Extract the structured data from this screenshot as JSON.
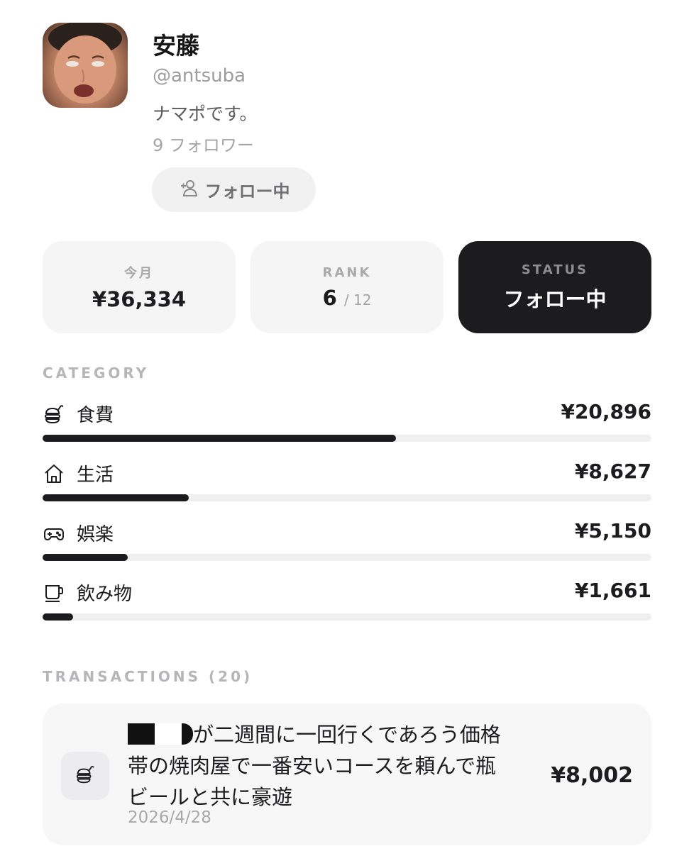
{
  "profile": {
    "name": "安藤",
    "handle": "@antsuba",
    "bio": "ナマポです。",
    "followers": "9 フォロワー",
    "follow_button": "フォロー中"
  },
  "stats": {
    "month": {
      "label": "今月",
      "value": "¥36,334"
    },
    "rank": {
      "label": "RANK",
      "value": "6",
      "total": "/ 12"
    },
    "status": {
      "label": "STATUS",
      "value": "フォロー中"
    }
  },
  "category_label": "CATEGORY",
  "categories": [
    {
      "name": "食費",
      "amount": "¥20,896",
      "icon": "food-icon",
      "share": 0.58
    },
    {
      "name": "生活",
      "amount": "¥8,627",
      "icon": "house-icon",
      "share": 0.24
    },
    {
      "name": "娯楽",
      "amount": "¥5,150",
      "icon": "gamepad-icon",
      "share": 0.14
    },
    {
      "name": "飲み物",
      "amount": "¥1,661",
      "icon": "cup-icon",
      "share": 0.05
    }
  ],
  "transactions_label": "TRANSACTIONS (20)",
  "transaction": {
    "description_line1": "が二週間に一回行くであろう価格",
    "description_line2": "帯の焼肉屋で一番安いコースを頼んで瓶",
    "description_line3": "ビールと共に豪遊",
    "date": "2026/4/28",
    "amount": "¥8,002",
    "icon": "food-icon"
  },
  "colors": {
    "dark": "#1c1c1e",
    "muted": "#a9a9ab",
    "card": "#f5f5f6"
  }
}
